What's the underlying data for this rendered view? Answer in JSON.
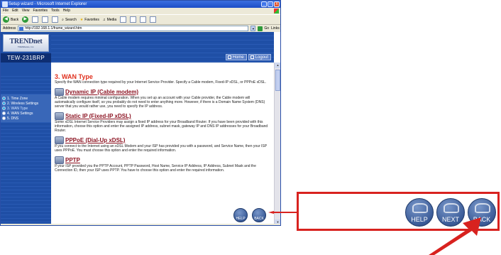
{
  "window": {
    "title": "Setup wizard - Microsoft Internet Explorer",
    "controls": [
      "_",
      "□",
      "X"
    ]
  },
  "menubar": {
    "items": [
      "File",
      "Edit",
      "View",
      "Favorites",
      "Tools",
      "Help"
    ]
  },
  "toolbar": {
    "back": "Back",
    "search": "Search",
    "favorites": "Favorites",
    "media": "Media"
  },
  "addressbar": {
    "label": "Address",
    "url": "http://192.168.1.1/frame_wizard.htm",
    "go": "Go",
    "links": "Links"
  },
  "sidebar": {
    "logo": "TRENDnet",
    "tagline": "TRENDware, Inc.",
    "model": "TEW-231BRP",
    "steps": [
      {
        "label": "1. Time Zone",
        "done": true
      },
      {
        "label": "2. Wireless Settings",
        "done": true
      },
      {
        "label": "3. WAN Type",
        "done": true
      },
      {
        "label": "4. WAN Settings",
        "done": false
      },
      {
        "label": "5. DNS",
        "done": false
      }
    ]
  },
  "header": {
    "home": "Home",
    "logout": "Logout"
  },
  "main": {
    "title": "3. WAN Type",
    "intro": "Specify the WAN connection type required by your Internet Service Provider. Specify a Cable modem, Fixed-IP xDSL, or PPPoE xDSL.",
    "options": [
      {
        "title": "Dynamic IP (Cable modem)",
        "desc": "A Cable modem requires minimal configuration. When you set up an account with your Cable provider, the Cable modem will automatically configure itself, so you probably do not need to enter anything more. However, if there is a Domain Name System (DNS) server that you would rather use, you need to specify the IP address."
      },
      {
        "title": "Static IP (Fixed-IP xDSL)",
        "desc": "Some xDSL Internet Service Providers may assign a fixed IP address for your Broadband Router. If you have been provided with this information, choose this option and enter the assigned IP address, subnet mask, gateway IP and DNS IP addresses for your Broadband Router."
      },
      {
        "title": "PPPoE (Dial-Up xDSL)",
        "desc": "If you connect to the Internet using an xDSL Modem and your ISP has provided you with a password, and Service Name, then your ISP uses PPPoE. You must choose this option and enter the required information."
      },
      {
        "title": "PPTP",
        "desc": "If your ISP provided you the PPTP Account, PPTP Password, Host Name, Service IP Address, IP Address, Subnet Mask and the Connection ID, then your ISP uses PPTP. You have to choose this option and enter the required information."
      }
    ],
    "help": "HELP",
    "back": "BACK"
  },
  "callout": {
    "help": "HELP",
    "next": "NEXT",
    "back": "BACK"
  },
  "colors": {
    "accent_red": "#d8221f",
    "nav_blue": "#1f4fa6",
    "title_red": "#e0301e"
  }
}
